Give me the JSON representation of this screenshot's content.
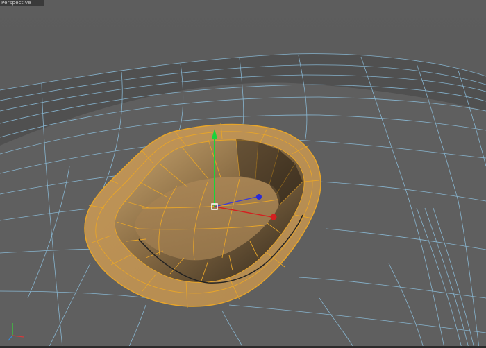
{
  "viewport": {
    "label": "Perspective",
    "background": "#5b5b5b"
  },
  "scene": {
    "surface_color": "#606060",
    "wireframe_color": "#8fc4e3",
    "selection_color": "#e7a52a",
    "mesh_fill": "#b08a52",
    "gizmo": {
      "y_axis_color": "#19d43a",
      "z_axis_color": "#2a2ad6",
      "x_axis_color": "#d42020",
      "pivot_color": "#ffffff"
    }
  },
  "view_axis": {
    "colors": {
      "x": "#d43a3a",
      "y": "#3ad43a",
      "z": "#3a8ad4"
    }
  }
}
